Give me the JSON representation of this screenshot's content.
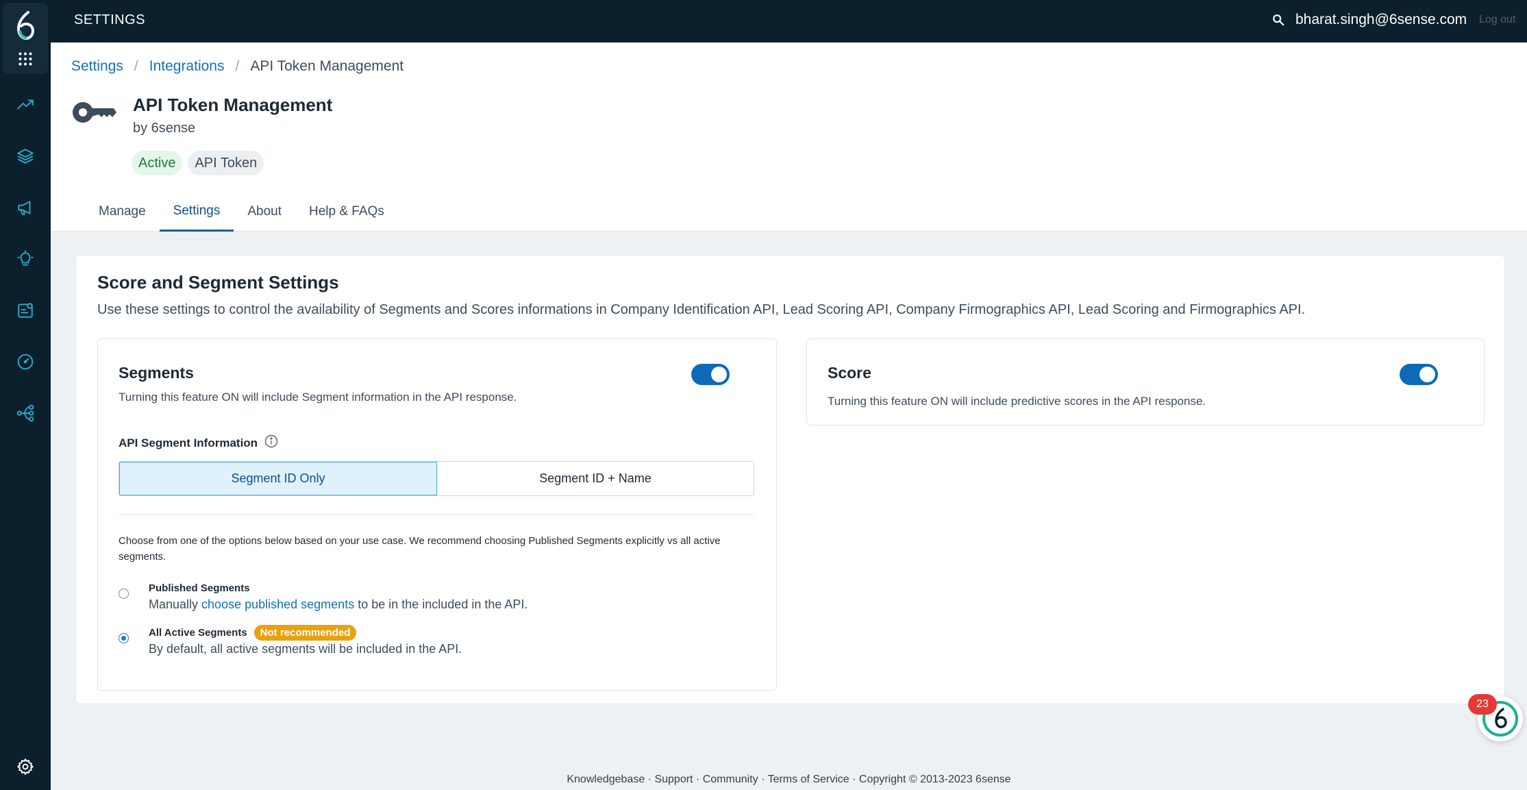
{
  "topbar": {
    "title": "SETTINGS",
    "user_email": "bharat.singh@6sense.com",
    "logout_label": "Log out"
  },
  "sidebar": {
    "logo_icon": "6sense-logo",
    "apps_icon": "apps-grid-icon",
    "items": [
      {
        "icon": "trending-up-icon"
      },
      {
        "icon": "layers-icon"
      },
      {
        "icon": "megaphone-icon"
      },
      {
        "icon": "lightbulb-icon"
      },
      {
        "icon": "reports-icon"
      },
      {
        "icon": "gauge-icon"
      },
      {
        "icon": "workflow-icon"
      }
    ],
    "settings_icon": "gear-icon"
  },
  "breadcrumb": {
    "items": [
      "Settings",
      "Integrations"
    ],
    "separator": "/",
    "current": "API Token Management"
  },
  "app": {
    "title": "API Token Management",
    "by": "by 6sense",
    "status_badge": "Active",
    "type_badge": "API Token"
  },
  "tabs": [
    {
      "label": "Manage",
      "selected": false
    },
    {
      "label": "Settings",
      "selected": true
    },
    {
      "label": "About",
      "selected": false
    },
    {
      "label": "Help & FAQs",
      "selected": false
    }
  ],
  "main": {
    "title": "Score and Segment Settings",
    "description": "Use these settings to control the availability of Segments and Scores informations in Company Identification API, Lead Scoring API, Company Firmographics API, Lead Scoring and Firmographics API.",
    "segments": {
      "title": "Segments",
      "enabled": true,
      "description": "Turning this feature ON will include Segment information in the API response.",
      "info_label": "API Segment Information",
      "options": [
        "Segment ID Only",
        "Segment ID + Name"
      ],
      "selected_option": "Segment ID Only",
      "choose_text": "Choose from one of the options below based on your use case. We recommend choosing Published Segments explicitly vs all active segments.",
      "published": {
        "title": "Published Segments",
        "sub_prefix": "Manually ",
        "link": "choose published segments",
        "sub_suffix": " to be in the included in the API.",
        "checked": false
      },
      "all_active": {
        "title": "All Active Segments",
        "badge": "Not recommended",
        "sub": "By default, all active segments will be included in the API.",
        "checked": true
      }
    },
    "score": {
      "title": "Score",
      "enabled": true,
      "description": "Turning this feature ON will include predictive scores in the API response."
    }
  },
  "widget": {
    "count": "23"
  },
  "footer": {
    "links": [
      "Knowledgebase",
      "Support",
      "Community",
      "Terms of Service"
    ],
    "separator": " · ",
    "copyright": "Copyright © 2013-2023 6sense"
  }
}
